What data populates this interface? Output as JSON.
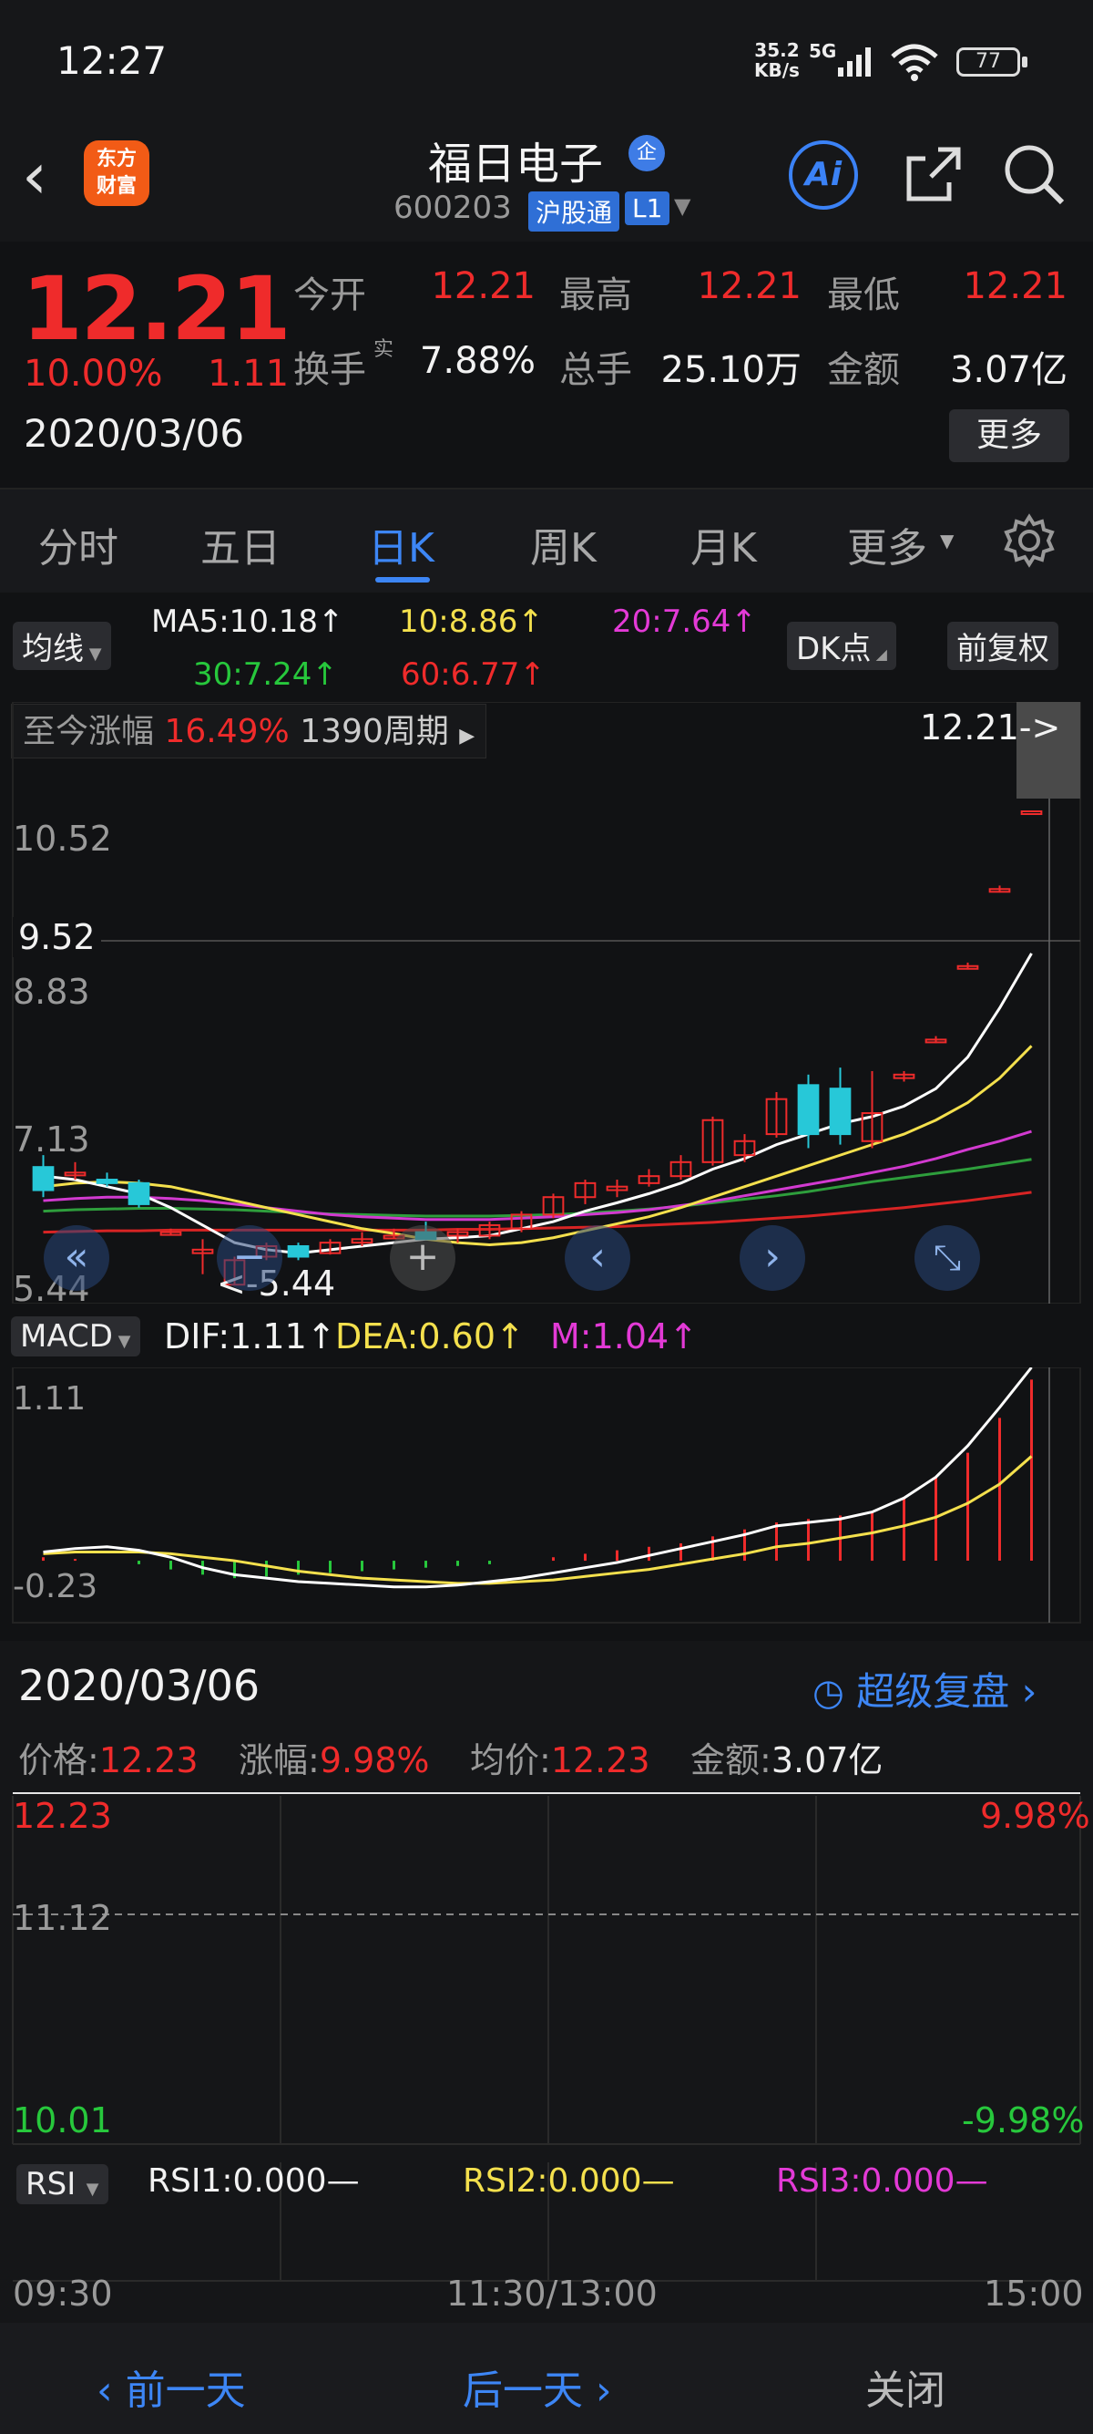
{
  "status_bar": {
    "time": "12:27",
    "net_speed": "35.2",
    "net_unit": "KB/s",
    "signal": "5G",
    "battery": "77"
  },
  "header": {
    "logo_line1": "东方",
    "logo_line2": "财富",
    "stock_name": "福日电子",
    "cert_badge": "企",
    "code": "600203",
    "market_tag": "沪股通",
    "level_tag": "L1",
    "ai_label": "Ai"
  },
  "quote": {
    "price": "12.21",
    "pct": "10.00%",
    "change": "1.11",
    "date": "2020/03/06",
    "open_label": "今开",
    "open": "12.21",
    "high_label": "最高",
    "high": "12.21",
    "low_label": "最低",
    "low": "12.21",
    "turnover_label": "换手",
    "turnover_sup": "实",
    "turnover": "7.88%",
    "volume_label": "总手",
    "volume": "25.10万",
    "amount_label": "金额",
    "amount": "3.07亿",
    "more_label": "更多"
  },
  "tabs": [
    {
      "label": "分时"
    },
    {
      "label": "五日"
    },
    {
      "label": "日K"
    },
    {
      "label": "周K"
    },
    {
      "label": "月K"
    },
    {
      "label": "更多"
    }
  ],
  "indicators": {
    "ma_selector": "均线",
    "ma5": "MA5:10.18↑",
    "ma10": "10:8.86↑",
    "ma20": "20:7.64↑",
    "ma30": "30:7.24↑",
    "ma60": "60:6.77↑",
    "dk_label": "DK点",
    "adjust_label": "前复权",
    "range_label": "至今涨幅",
    "range_pct": "16.49%",
    "range_period": "1390周期",
    "last_price_marker": "12.21->",
    "axis_top": "10.52",
    "axis_cross": "9.52",
    "axis_mid": "8.83",
    "axis_low": "7.13",
    "axis_bottom": "5.44",
    "min_marker": "<-5.44",
    "macd_selector": "MACD",
    "dif": "DIF:1.11↑",
    "dea": "DEA:0.60↑",
    "m": "M:1.04↑",
    "macd_top": "1.11",
    "macd_bottom": "-0.23"
  },
  "chart_data": [
    {
      "type": "candlestick",
      "title": "",
      "ylim": [
        5.44,
        12.21
      ],
      "candles": [
        {
          "o": 7.13,
          "h": 7.3,
          "l": 6.7,
          "c": 6.8
        },
        {
          "o": 7.05,
          "h": 7.2,
          "l": 6.95,
          "c": 7.05
        },
        {
          "o": 6.95,
          "h": 7.05,
          "l": 6.85,
          "c": 6.9
        },
        {
          "o": 6.9,
          "h": 6.95,
          "l": 6.55,
          "c": 6.6
        },
        {
          "o": 6.2,
          "h": 6.25,
          "l": 6.15,
          "c": 6.2
        },
        {
          "o": 5.9,
          "h": 6.1,
          "l": 5.6,
          "c": 5.95
        },
        {
          "o": 5.45,
          "h": 5.85,
          "l": 5.44,
          "c": 5.8
        },
        {
          "o": 5.85,
          "h": 6.05,
          "l": 5.8,
          "c": 6.0
        },
        {
          "o": 6.0,
          "h": 6.05,
          "l": 5.8,
          "c": 5.85
        },
        {
          "o": 5.9,
          "h": 6.1,
          "l": 5.88,
          "c": 6.05
        },
        {
          "o": 6.05,
          "h": 6.2,
          "l": 6.0,
          "c": 6.1
        },
        {
          "o": 6.15,
          "h": 6.25,
          "l": 6.1,
          "c": 6.15
        },
        {
          "o": 6.2,
          "h": 6.35,
          "l": 6.1,
          "c": 6.1
        },
        {
          "o": 6.15,
          "h": 6.25,
          "l": 6.05,
          "c": 6.2
        },
        {
          "o": 6.15,
          "h": 6.35,
          "l": 6.1,
          "c": 6.3
        },
        {
          "o": 6.25,
          "h": 6.5,
          "l": 6.2,
          "c": 6.45
        },
        {
          "o": 6.45,
          "h": 6.75,
          "l": 6.4,
          "c": 6.7
        },
        {
          "o": 6.7,
          "h": 6.95,
          "l": 6.6,
          "c": 6.9
        },
        {
          "o": 6.8,
          "h": 6.95,
          "l": 6.7,
          "c": 6.85
        },
        {
          "o": 6.9,
          "h": 7.1,
          "l": 6.85,
          "c": 7.0
        },
        {
          "o": 7.0,
          "h": 7.3,
          "l": 6.95,
          "c": 7.2
        },
        {
          "o": 7.2,
          "h": 7.85,
          "l": 7.15,
          "c": 7.8
        },
        {
          "o": 7.3,
          "h": 7.6,
          "l": 7.2,
          "c": 7.5
        },
        {
          "o": 7.6,
          "h": 8.2,
          "l": 7.55,
          "c": 8.1
        },
        {
          "o": 8.3,
          "h": 8.45,
          "l": 7.4,
          "c": 7.6
        },
        {
          "o": 8.25,
          "h": 8.55,
          "l": 7.45,
          "c": 7.6
        },
        {
          "o": 7.5,
          "h": 8.5,
          "l": 7.4,
          "c": 7.9
        },
        {
          "o": 8.4,
          "h": 8.5,
          "l": 8.35,
          "c": 8.45
        },
        {
          "o": 8.95,
          "h": 9.0,
          "l": 8.9,
          "c": 8.95
        },
        {
          "o": 10.0,
          "h": 10.05,
          "l": 9.95,
          "c": 10.0
        },
        {
          "o": 11.1,
          "h": 11.15,
          "l": 11.05,
          "c": 11.1
        },
        {
          "o": 12.21,
          "h": 12.21,
          "l": 12.21,
          "c": 12.21
        }
      ],
      "ma5": [
        7.0,
        6.95,
        6.85,
        6.75,
        6.55,
        6.3,
        6.05,
        5.95,
        5.9,
        5.95,
        6.0,
        6.05,
        6.1,
        6.12,
        6.15,
        6.25,
        6.35,
        6.5,
        6.62,
        6.75,
        6.9,
        7.1,
        7.25,
        7.45,
        7.6,
        7.75,
        7.85,
        8.0,
        8.25,
        8.7,
        9.4,
        10.18
      ],
      "ma10": [
        6.85,
        6.9,
        6.92,
        6.9,
        6.85,
        6.75,
        6.65,
        6.55,
        6.45,
        6.35,
        6.25,
        6.18,
        6.1,
        6.05,
        6.02,
        6.05,
        6.12,
        6.22,
        6.32,
        6.42,
        6.55,
        6.7,
        6.85,
        7.0,
        7.15,
        7.3,
        7.45,
        7.6,
        7.8,
        8.05,
        8.4,
        8.86
      ],
      "ma20": [
        6.65,
        6.68,
        6.7,
        6.7,
        6.68,
        6.65,
        6.6,
        6.55,
        6.5,
        6.45,
        6.42,
        6.4,
        6.38,
        6.38,
        6.38,
        6.4,
        6.42,
        6.45,
        6.48,
        6.52,
        6.58,
        6.64,
        6.72,
        6.8,
        6.88,
        6.96,
        7.05,
        7.14,
        7.25,
        7.38,
        7.5,
        7.64
      ],
      "ma30": [
        6.5,
        6.52,
        6.53,
        6.54,
        6.54,
        6.53,
        6.52,
        6.5,
        6.48,
        6.46,
        6.45,
        6.44,
        6.43,
        6.43,
        6.43,
        6.44,
        6.45,
        6.47,
        6.5,
        6.53,
        6.57,
        6.62,
        6.67,
        6.72,
        6.78,
        6.85,
        6.92,
        6.98,
        7.04,
        7.1,
        7.17,
        7.24
      ],
      "ma60": [
        6.2,
        6.21,
        6.22,
        6.22,
        6.23,
        6.23,
        6.23,
        6.23,
        6.23,
        6.23,
        6.23,
        6.23,
        6.23,
        6.24,
        6.24,
        6.25,
        6.26,
        6.27,
        6.28,
        6.3,
        6.32,
        6.34,
        6.37,
        6.4,
        6.43,
        6.47,
        6.51,
        6.55,
        6.6,
        6.65,
        6.71,
        6.77
      ]
    },
    {
      "type": "bar",
      "title": "",
      "ylim": [
        -0.23,
        1.11
      ],
      "macd_hist": [
        0.02,
        0.01,
        0.0,
        -0.02,
        -0.05,
        -0.08,
        -0.1,
        -0.09,
        -0.08,
        -0.07,
        -0.06,
        -0.05,
        -0.04,
        -0.03,
        -0.02,
        0.0,
        0.02,
        0.04,
        0.06,
        0.08,
        0.1,
        0.14,
        0.18,
        0.22,
        0.24,
        0.26,
        0.28,
        0.36,
        0.48,
        0.62,
        0.82,
        1.04
      ],
      "dif": [
        0.05,
        0.07,
        0.08,
        0.06,
        0.02,
        -0.04,
        -0.08,
        -0.1,
        -0.12,
        -0.13,
        -0.14,
        -0.15,
        -0.15,
        -0.14,
        -0.12,
        -0.1,
        -0.07,
        -0.04,
        -0.01,
        0.03,
        0.07,
        0.11,
        0.15,
        0.2,
        0.22,
        0.24,
        0.28,
        0.36,
        0.48,
        0.66,
        0.88,
        1.11
      ],
      "dea": [
        0.04,
        0.05,
        0.05,
        0.05,
        0.04,
        0.02,
        0.0,
        -0.03,
        -0.06,
        -0.08,
        -0.1,
        -0.11,
        -0.12,
        -0.13,
        -0.13,
        -0.12,
        -0.11,
        -0.09,
        -0.07,
        -0.05,
        -0.02,
        0.01,
        0.04,
        0.08,
        0.1,
        0.13,
        0.16,
        0.2,
        0.25,
        0.33,
        0.44,
        0.6
      ]
    }
  ],
  "overlay_icons": [
    "double-left-icon",
    "zoom-out-icon",
    "zoom-in-icon",
    "prev-icon",
    "next-icon",
    "expand-icon"
  ],
  "panel": {
    "date": "2020/03/06",
    "super_review": "超级复盘",
    "price_label": "价格:",
    "price": "12.23",
    "pct_label": "涨幅:",
    "pct": "9.98%",
    "avg_label": "均价:",
    "avg": "12.23",
    "amount_label": "金额:",
    "amount": "3.07亿",
    "y_top": "12.23",
    "y_mid": "11.12",
    "y_bottom": "10.01",
    "pct_top": "9.98%",
    "pct_bottom": "-9.98%",
    "rsi_selector": "RSI",
    "rsi1": "RSI1:0.000—",
    "rsi2": "RSI2:0.000—",
    "rsi3": "RSI3:0.000—",
    "t_start": "09:30",
    "t_mid": "11:30/13:00",
    "t_end": "15:00"
  },
  "bottom_bar": {
    "prev": "前一天",
    "next": "后一天",
    "close": "关闭"
  },
  "colors": {
    "up": "#ef2b2b",
    "down": "#27c8d8",
    "accent": "#3d86f5",
    "ma5": "#ffffff",
    "ma10": "#f4e04d",
    "ma20": "#d23ad0",
    "ma30": "#2e9e3c",
    "ma60": "#d82424"
  }
}
